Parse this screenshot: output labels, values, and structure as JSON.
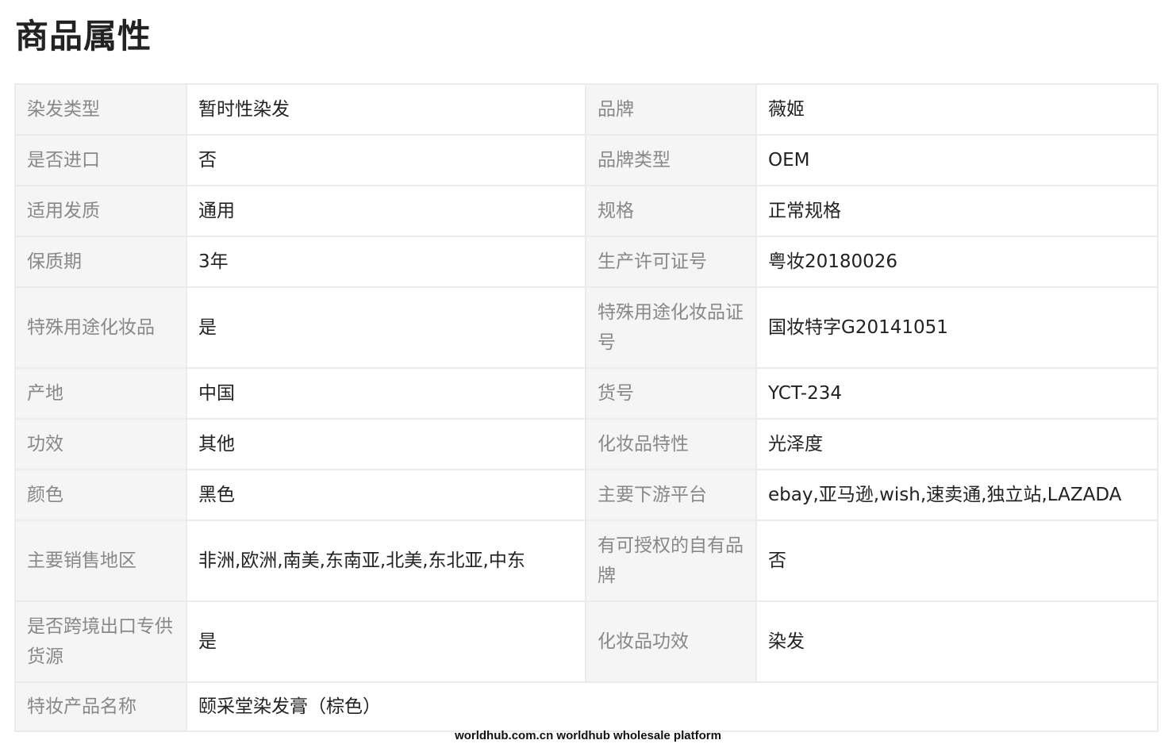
{
  "page_title": "商品属性",
  "rows": [
    {
      "l1": "染发类型",
      "v1": "暂时性染发",
      "l2": "品牌",
      "v2": "薇姬"
    },
    {
      "l1": "是否进口",
      "v1": "否",
      "l2": "品牌类型",
      "v2": "OEM"
    },
    {
      "l1": "适用发质",
      "v1": "通用",
      "l2": "规格",
      "v2": "正常规格"
    },
    {
      "l1": "保质期",
      "v1": "3年",
      "l2": "生产许可证号",
      "v2": "粤妆20180026"
    },
    {
      "l1": "特殊用途化妆品",
      "v1": "是",
      "l2": "特殊用途化妆品证号",
      "v2": "国妆特字G20141051"
    },
    {
      "l1": "产地",
      "v1": "中国",
      "l2": "货号",
      "v2": "YCT-234"
    },
    {
      "l1": "功效",
      "v1": "其他",
      "l2": "化妆品特性",
      "v2": "光泽度"
    },
    {
      "l1": "颜色",
      "v1": "黑色",
      "l2": "主要下游平台",
      "v2": "ebay,亚马逊,wish,速卖通,独立站,LAZADA"
    },
    {
      "l1": "主要销售地区",
      "v1": "非洲,欧洲,南美,东南亚,北美,东北亚,中东",
      "l2": "有可授权的自有品牌",
      "v2": "否"
    },
    {
      "l1": "是否跨境出口专供货源",
      "v1": "是",
      "l2": "化妆品功效",
      "v2": "染发"
    },
    {
      "l1": "特妆产品名称",
      "v1": "颐采堂染发膏（棕色）"
    }
  ],
  "footer_watermark": "worldhub.com.cn worldhub wholesale platform"
}
